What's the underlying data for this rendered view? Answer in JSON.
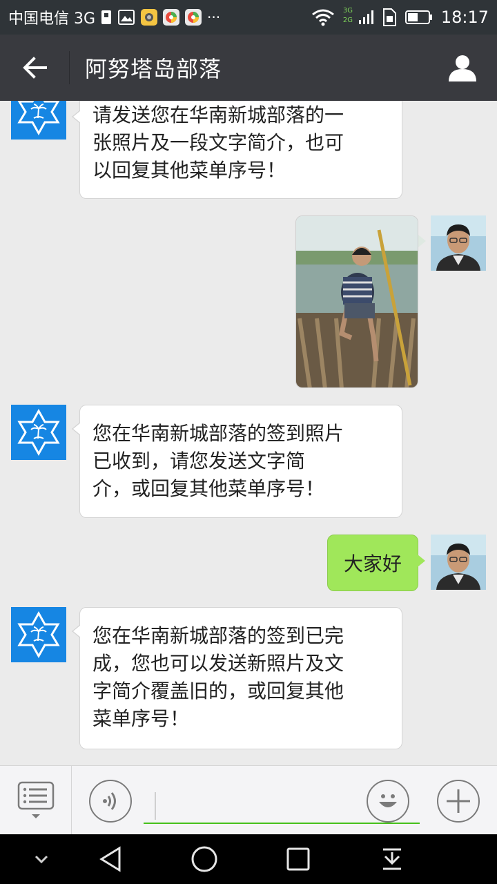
{
  "status_bar": {
    "carrier": "中国电信 3G",
    "network_small": "3G",
    "network_small2": "2G",
    "dots": "···",
    "time": "18:17"
  },
  "header": {
    "title": "阿努塔岛部落"
  },
  "messages": [
    {
      "from": "bot",
      "lines": [
        "请发送您在华南新城部落的一",
        "张照片及一段文字简介，也可",
        "以回复其他菜单序号！"
      ]
    },
    {
      "from": "user",
      "kind": "photo"
    },
    {
      "from": "bot",
      "lines": [
        "您在华南新城部落的签到照片",
        "已收到，请您发送文字简",
        "介，或回复其他菜单序号！"
      ]
    },
    {
      "from": "user",
      "kind": "text",
      "text": "大家好"
    },
    {
      "from": "bot",
      "lines": [
        "您在华南新城部落的签到已完",
        "成，您也可以发送新照片及文",
        "字简介覆盖旧的，或回复其他",
        "菜单序号！"
      ]
    }
  ],
  "input": {
    "value": "",
    "placeholder": ""
  },
  "colors": {
    "status_bar": "#2f3438",
    "title_bar": "#393a3f",
    "chat_bg": "#ebebeb",
    "bot_avatar": "#1686e3",
    "own_bubble": "#a0e75a",
    "input_underline": "#45c01a"
  },
  "icons": [
    "back-arrow-icon",
    "profile-icon",
    "menu-list-icon",
    "voice-icon",
    "emoji-icon",
    "plus-icon",
    "nav-back-icon",
    "nav-home-icon",
    "nav-recent-icon",
    "nav-collapse-icon",
    "nav-notification-icon",
    "wifi-icon",
    "battery-icon"
  ]
}
